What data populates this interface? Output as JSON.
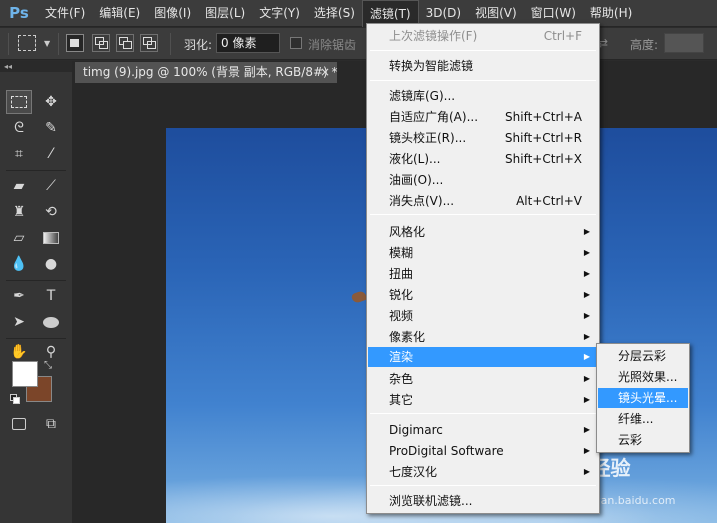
{
  "app": {
    "logo": "Ps"
  },
  "menubar": {
    "items": [
      "文件(F)",
      "编辑(E)",
      "图像(I)",
      "图层(L)",
      "文字(Y)",
      "选择(S)",
      "滤镜(T)",
      "3D(D)",
      "视图(V)",
      "窗口(W)",
      "帮助(H)"
    ],
    "active_index": 6
  },
  "options": {
    "feather_label": "羽化:",
    "feather_value": "0 像素",
    "antialias_label": "消除锯齿",
    "height_label": "高度:"
  },
  "document": {
    "tab_title": "timg (9).jpg @ 100% (背景 副本, RGB/8#) *",
    "close_glyph": "×"
  },
  "colors": {
    "foreground": "#ffffff",
    "background": "#7b4529",
    "highlight": "#3399ff"
  },
  "filter_menu": {
    "items": [
      {
        "label": "上次滤镜操作(F)",
        "shortcut": "Ctrl+F",
        "disabled": true
      },
      {
        "label": "转换为智能滤镜"
      },
      {
        "label": "滤镜库(G)..."
      },
      {
        "label": "自适应广角(A)...",
        "shortcut": "Shift+Ctrl+A"
      },
      {
        "label": "镜头校正(R)...",
        "shortcut": "Shift+Ctrl+R"
      },
      {
        "label": "液化(L)...",
        "shortcut": "Shift+Ctrl+X"
      },
      {
        "label": "油画(O)..."
      },
      {
        "label": "消失点(V)...",
        "shortcut": "Alt+Ctrl+V"
      },
      {
        "label": "风格化",
        "submenu": true
      },
      {
        "label": "模糊",
        "submenu": true
      },
      {
        "label": "扭曲",
        "submenu": true
      },
      {
        "label": "锐化",
        "submenu": true
      },
      {
        "label": "视频",
        "submenu": true
      },
      {
        "label": "像素化",
        "submenu": true
      },
      {
        "label": "渲染",
        "submenu": true,
        "highlighted": true
      },
      {
        "label": "杂色",
        "submenu": true
      },
      {
        "label": "其它",
        "submenu": true
      },
      {
        "label": "Digimarc",
        "submenu": true
      },
      {
        "label": "ProDigital Software",
        "submenu": true
      },
      {
        "label": "七度汉化",
        "submenu": true
      },
      {
        "label": "浏览联机滤镜..."
      }
    ]
  },
  "render_submenu": {
    "items": [
      {
        "label": "分层云彩"
      },
      {
        "label": "光照效果..."
      },
      {
        "label": "镜头光晕...",
        "highlighted": true
      },
      {
        "label": "纤维..."
      },
      {
        "label": "云彩"
      }
    ]
  },
  "watermark": {
    "logo": "Bai 经验",
    "url": "jingyan.baidu.com"
  },
  "icons": {
    "toolbox": [
      "marquee-icon",
      "move-icon",
      "lasso-icon",
      "quick-select-icon",
      "crop-icon",
      "eyedropper-icon",
      "healing-brush-icon",
      "brush-icon",
      "clone-stamp-icon",
      "history-brush-icon",
      "eraser-icon",
      "gradient-icon",
      "blur-icon",
      "dodge-icon",
      "pen-icon",
      "type-icon",
      "path-select-icon",
      "ellipse-icon",
      "hand-icon",
      "zoom-icon",
      "quick-mask-icon",
      "screen-mode-icon"
    ]
  }
}
